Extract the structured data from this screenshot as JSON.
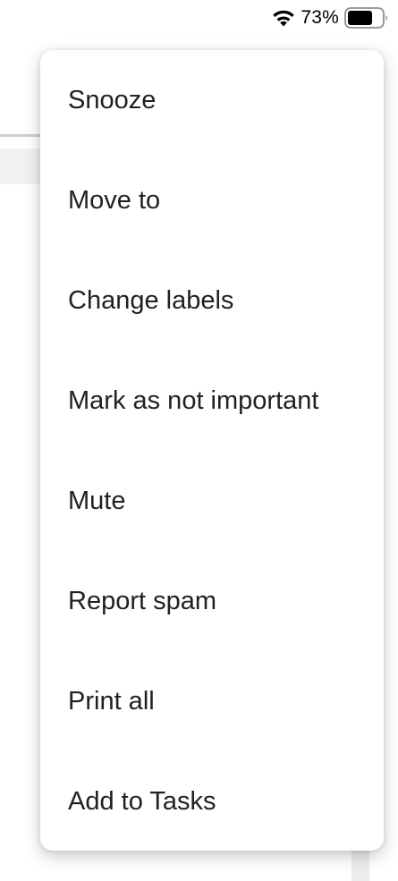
{
  "status_bar": {
    "battery_percent": "73%",
    "battery_level": 0.73,
    "icons": [
      "wifi-icon",
      "battery-icon"
    ]
  },
  "menu": {
    "items": [
      {
        "label": "Snooze"
      },
      {
        "label": "Move to"
      },
      {
        "label": "Change labels"
      },
      {
        "label": "Mark as not important"
      },
      {
        "label": "Mute"
      },
      {
        "label": "Report spam"
      },
      {
        "label": "Print all"
      },
      {
        "label": "Add to Tasks"
      }
    ]
  },
  "colors": {
    "menu_text": "#202124",
    "menu_background": "#ffffff"
  }
}
